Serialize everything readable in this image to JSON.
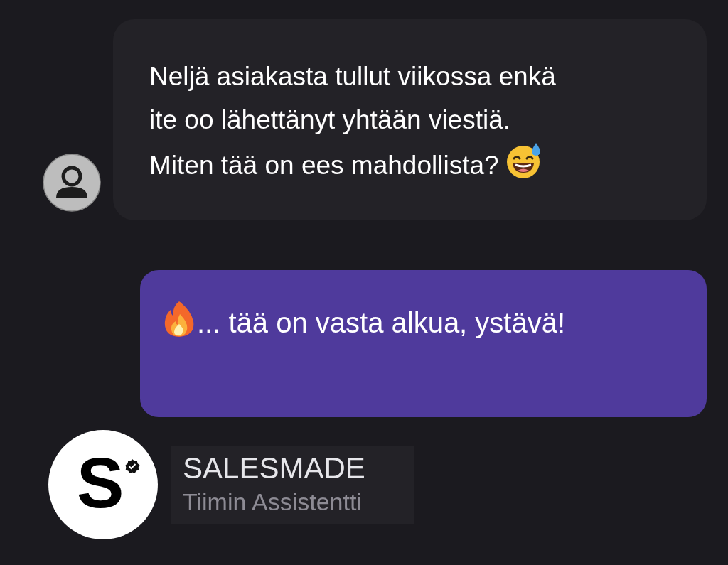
{
  "messages": [
    {
      "kind": "incoming",
      "text": "Neljä asiakasta tullut viikossa enkä\nite oo lähettänyt yhtään viestiä.\nMiten tää on ees mahdollista?"
    },
    {
      "kind": "outgoing",
      "text": "... tää on vasta alkua, ystävä!"
    }
  ],
  "sender": {
    "logo_letter": "S",
    "name": "SALESMADE",
    "role": "Tiimin Assistentti"
  }
}
